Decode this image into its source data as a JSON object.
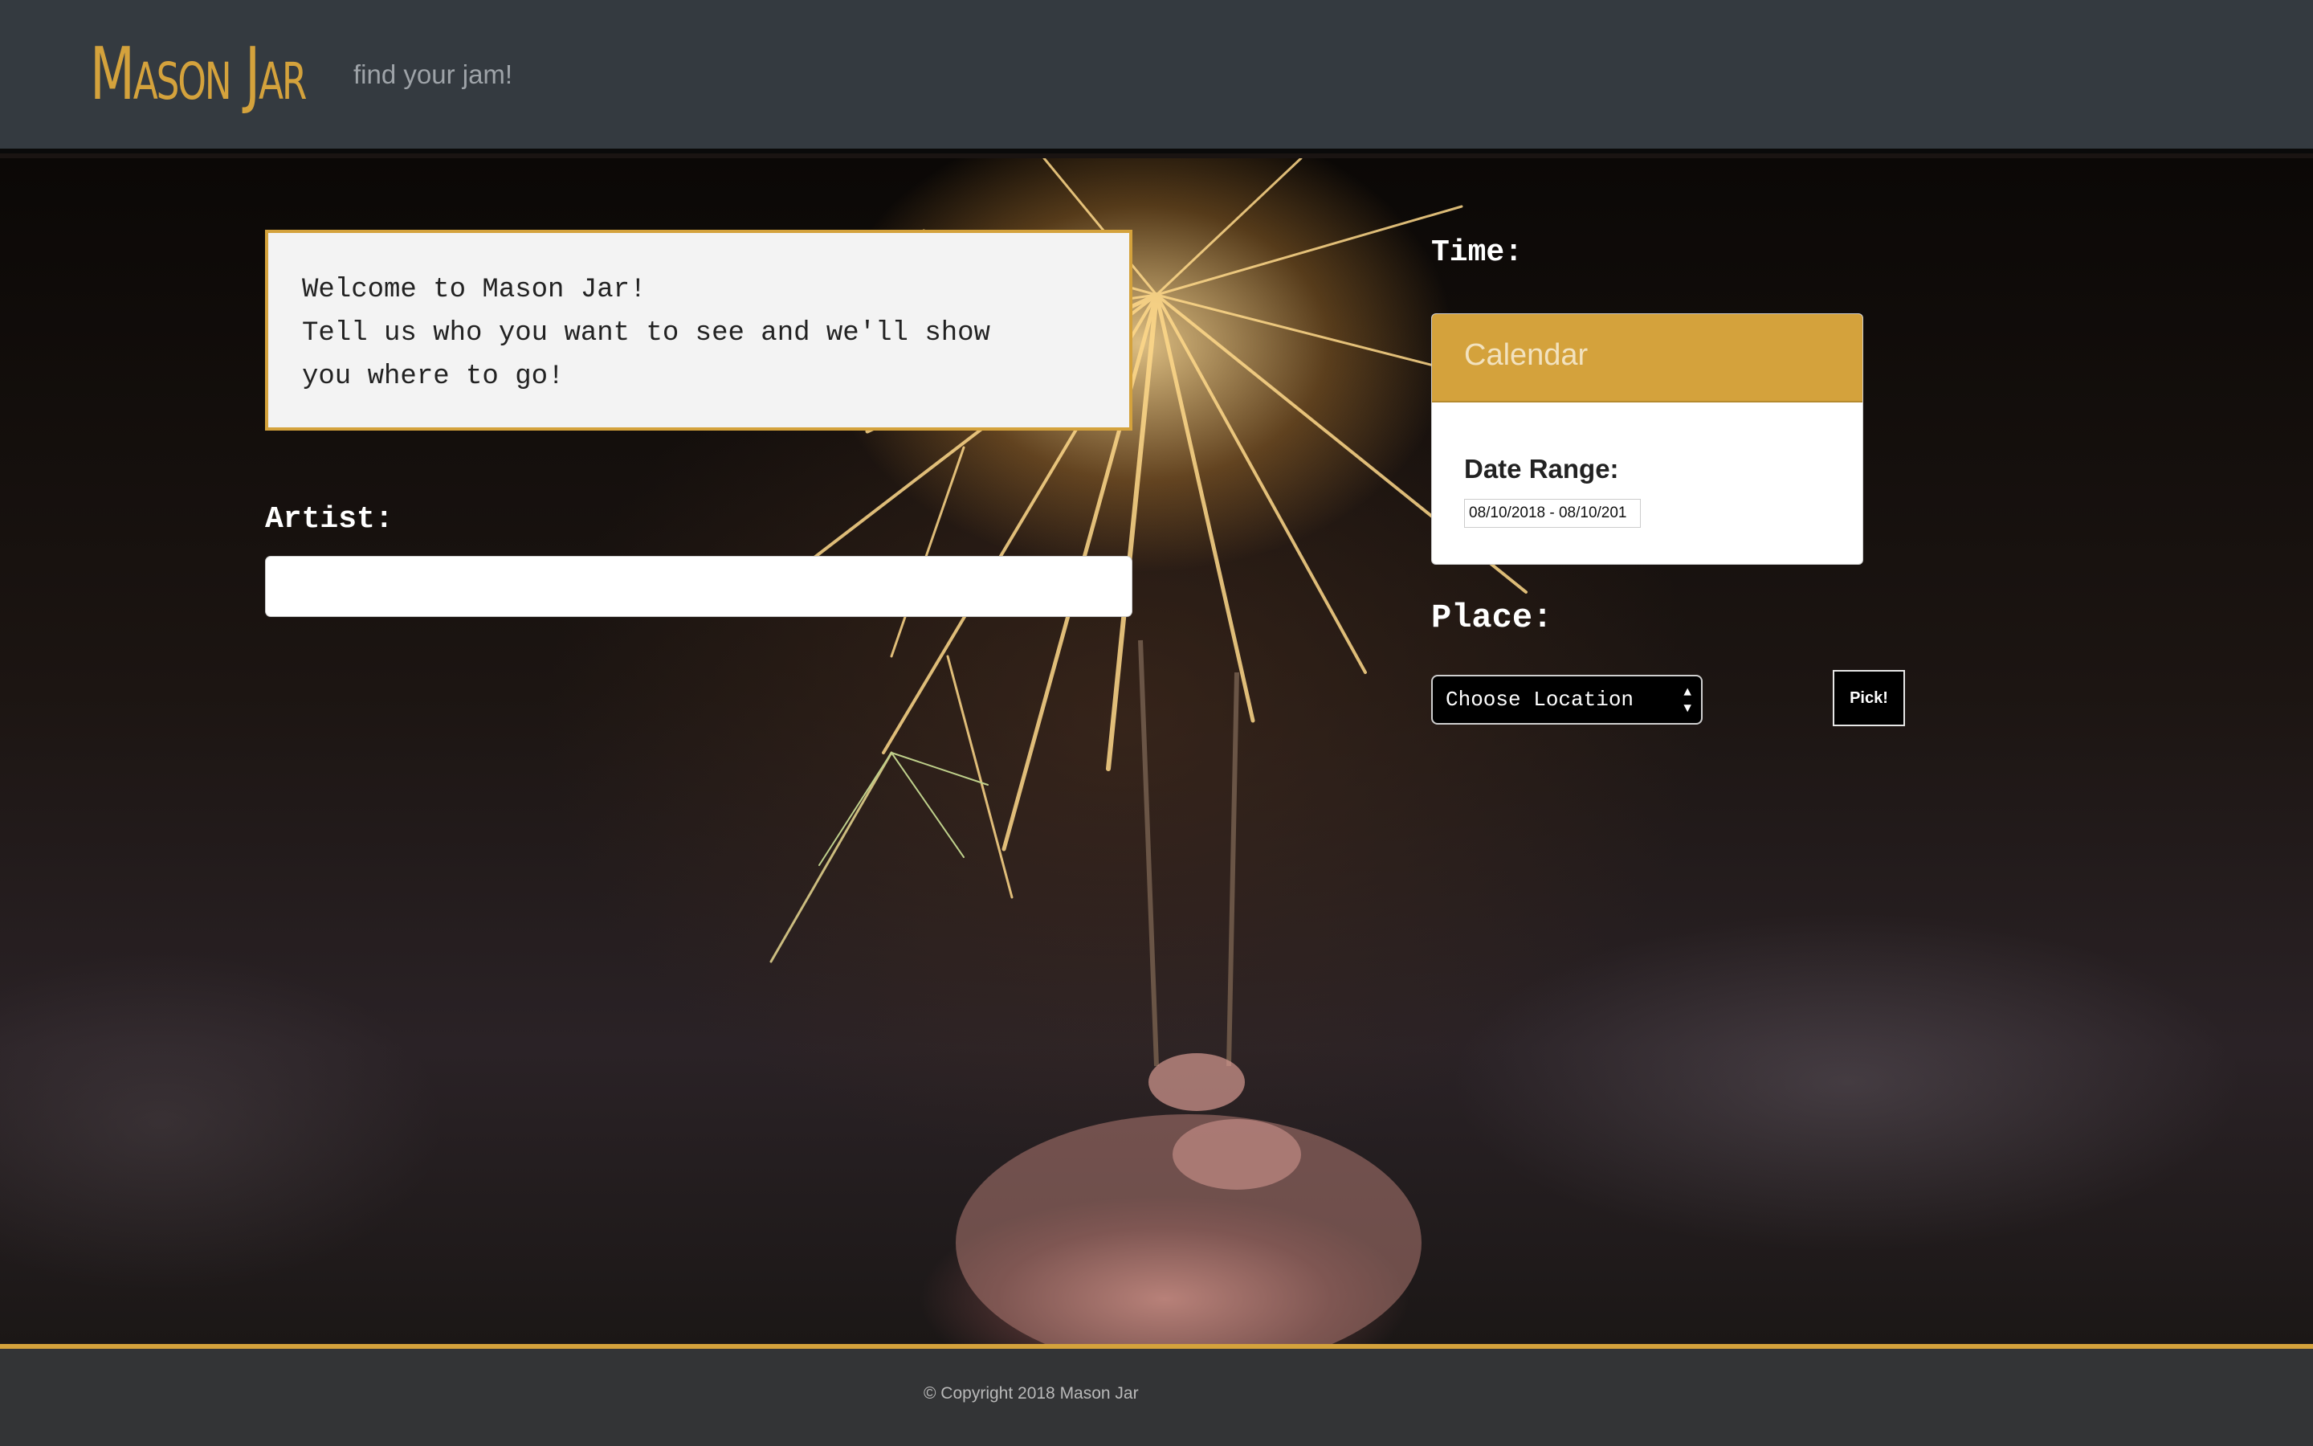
{
  "header": {
    "brand": "Mason Jar",
    "tagline": "find your jam!"
  },
  "welcome": {
    "line1": "Welcome to Mason Jar!",
    "line2": "Tell us who you want to see and we'll show",
    "line3": "you where to go!"
  },
  "artist": {
    "label": "Artist:",
    "value": ""
  },
  "time": {
    "label": "Time:",
    "calendar_title": "Calendar",
    "range_label": "Date Range:",
    "range_value": "08/10/2018 - 08/10/201"
  },
  "place": {
    "label": "Place:",
    "select_value": "Choose Location",
    "pick_button": "Pick!"
  },
  "footer": {
    "copyright": "© Copyright 2018 Mason Jar"
  },
  "colors": {
    "accent": "#d4a23c",
    "header_bg": "#343a40",
    "footer_bg": "#333436"
  },
  "icons": {
    "select_arrows": "updown-arrows-icon"
  }
}
